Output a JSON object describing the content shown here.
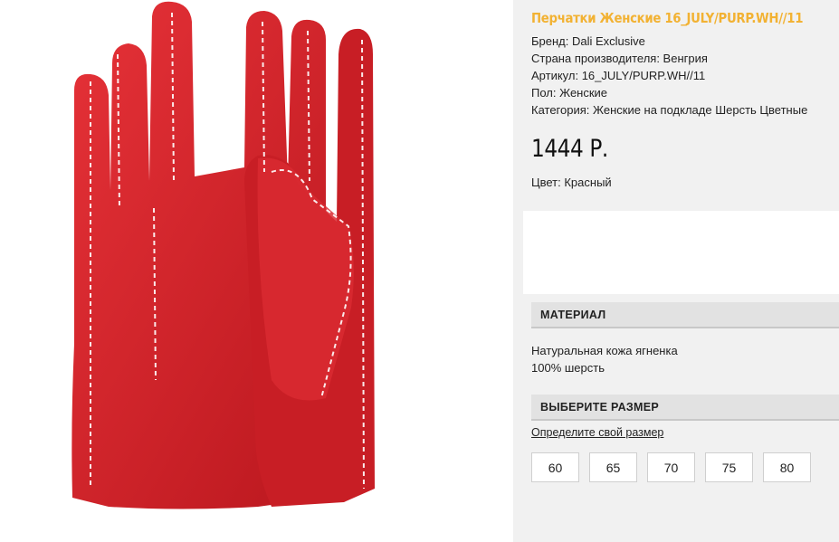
{
  "product": {
    "title": "Перчатки Женские 16_JULY/PURP.WH//11",
    "specs": [
      "Бренд: Dali Exclusive",
      "Страна производителя: Венгрия",
      "Артикул: 16_JULY/PURP.WH//11",
      "Пол: Женские",
      "Категория: Женские на подкладе Шерсть Цветные"
    ],
    "price": "1444 Р.",
    "color_line": "Цвет: Красный",
    "image_icon": "red-leather-gloves-photo"
  },
  "material": {
    "heading": "МАТЕРИАЛ",
    "lines": [
      "Натуральная кожа ягненка",
      "100% шерсть"
    ]
  },
  "size": {
    "heading": "ВЫБЕРИТЕ РАЗМЕР",
    "link": "Определите свой размер",
    "options": [
      "60",
      "65",
      "70",
      "75",
      "80"
    ]
  },
  "colors": {
    "title": "#f2b233",
    "glove": "#d8252b",
    "panel": "#f1f1f1"
  }
}
